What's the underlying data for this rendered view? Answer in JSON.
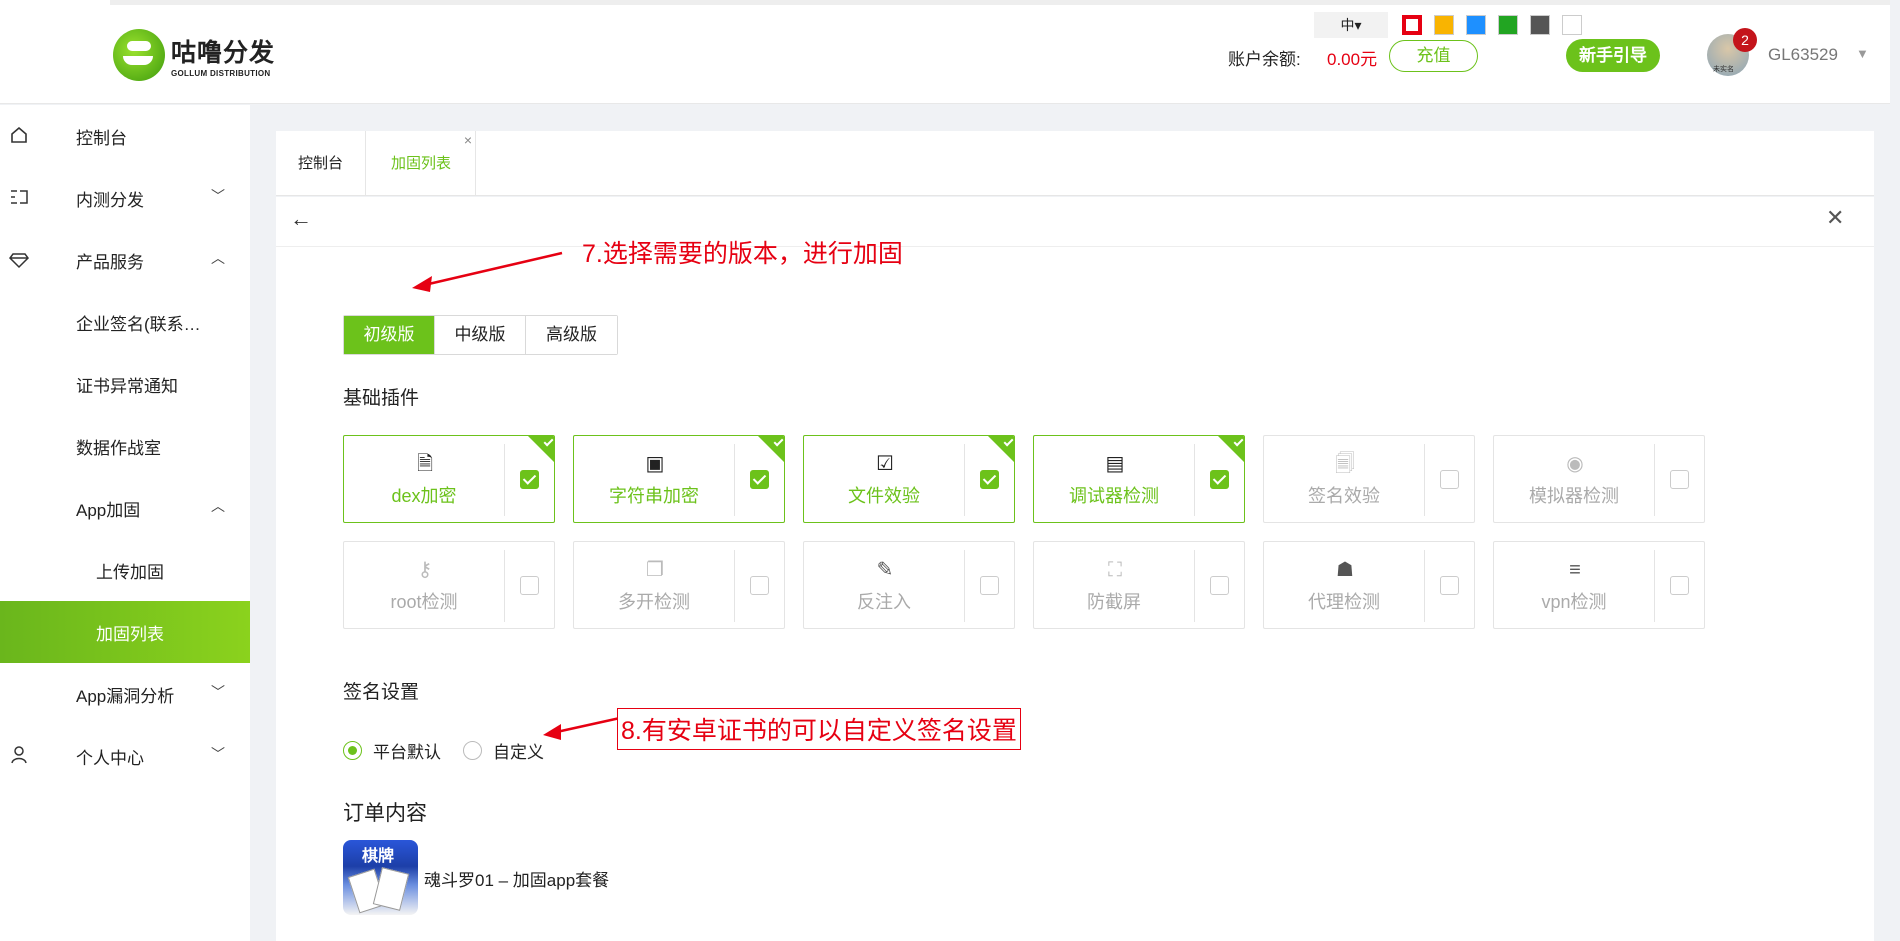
{
  "header": {
    "logo_cn": "咕噜分发",
    "logo_en": "GOLLUM DISTRIBUTION",
    "lang": "中▾",
    "theme_colors": [
      "#e60012",
      "#f9b401",
      "#1e90ff",
      "#22a522",
      "#555555",
      "#ffffff"
    ],
    "balance_label": "账户余额:",
    "balance_value": "0.00元",
    "recharge": "充值",
    "guide": "新手引导",
    "notifications": "2",
    "avatar_caption": "未实名",
    "username": "GL63529"
  },
  "sidebar": {
    "items": [
      {
        "label": "控制台",
        "icon": "home-icon"
      },
      {
        "label": "内测分发",
        "icon": "flow-icon",
        "caret": "⌄"
      },
      {
        "label": "产品服务",
        "icon": "diamond-icon",
        "caret": "⌃"
      },
      {
        "label": "企业签名(联系…"
      },
      {
        "label": "证书异常通知"
      },
      {
        "label": "数据作战室"
      },
      {
        "label": "App加固",
        "caret": "⌃"
      },
      {
        "label": "上传加固"
      },
      {
        "label": "加固列表"
      },
      {
        "label": "App漏洞分析",
        "caret": "⌄"
      },
      {
        "label": "个人中心",
        "icon": "user-icon",
        "caret": "⌄"
      }
    ]
  },
  "tabs": {
    "home": "控制台",
    "active": "加固列表",
    "close": "×"
  },
  "panel": {
    "back": "←",
    "close": "✕",
    "annotation1": "7.选择需要的版本，进行加固",
    "annotation2": "8.有安卓证书的可以自定义签名设置",
    "versions": [
      "初级版",
      "中级版",
      "高级版"
    ],
    "plugins_title": "基础插件",
    "plugins": [
      {
        "name": "dex加密",
        "icon": "document-lock-icon",
        "checked": true
      },
      {
        "name": "字符串加密",
        "icon": "file-lock-icon",
        "checked": true
      },
      {
        "name": "文件效验",
        "icon": "file-check-icon",
        "checked": true
      },
      {
        "name": "调试器检测",
        "icon": "film-icon",
        "checked": true
      },
      {
        "name": "签名效验",
        "icon": "doc-search-icon",
        "checked": false
      },
      {
        "name": "模拟器检测",
        "icon": "phone-eye-icon",
        "checked": false
      },
      {
        "name": "root检测",
        "icon": "key-icon",
        "checked": false
      },
      {
        "name": "多开检测",
        "icon": "file-copy-icon",
        "checked": false
      },
      {
        "name": "反注入",
        "icon": "syringe-icon",
        "checked": false
      },
      {
        "name": "防截屏",
        "icon": "screen-crop-icon",
        "checked": false
      },
      {
        "name": "代理检测",
        "icon": "proxy-user-icon",
        "checked": false
      },
      {
        "name": "vpn检测",
        "icon": "vpn-icon",
        "checked": false
      }
    ],
    "signature_title": "签名设置",
    "radio_default": "平台默认",
    "radio_custom": "自定义",
    "order_title": "订单内容",
    "order_icon_tag": "棋牌",
    "order_name": "魂斗罗01 – 加固app套餐"
  }
}
